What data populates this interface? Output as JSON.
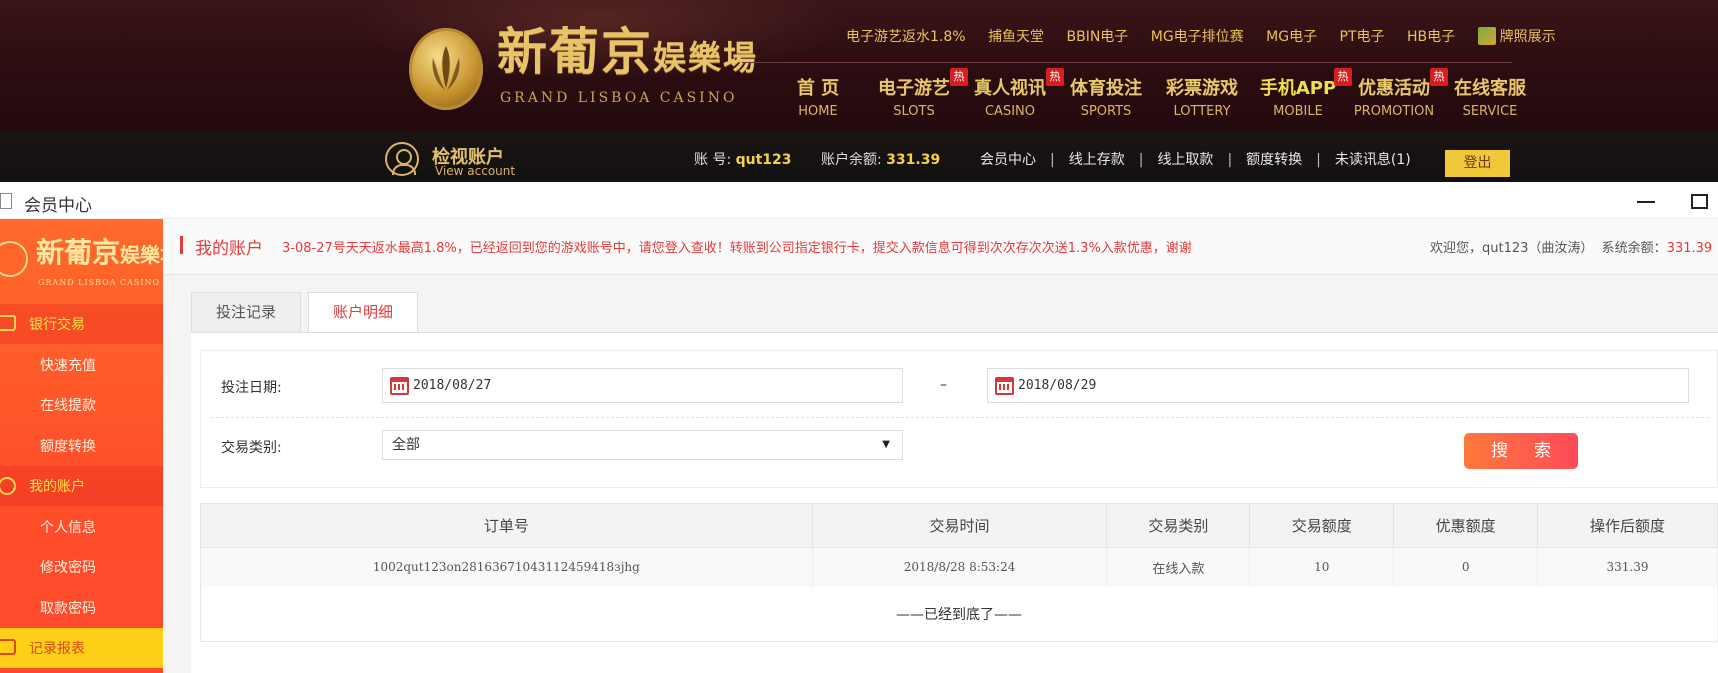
{
  "header": {
    "logo_cn_main": "新葡京",
    "logo_cn_small": "娱樂場",
    "logo_en": "GRAND LISBOA CASINO",
    "top_links": [
      "电子游艺返水1.8%",
      "捕鱼天堂",
      "BBIN电子",
      "MG电子排位赛",
      "MG电子",
      "PT电子",
      "HB电子"
    ],
    "license_link": "牌照展示",
    "nav": [
      {
        "cn": "首 页",
        "en": "HOME",
        "hot": ""
      },
      {
        "cn": "电子游艺",
        "en": "SLOTS",
        "hot": "热"
      },
      {
        "cn": "真人视讯",
        "en": "CASINO",
        "hot": "热"
      },
      {
        "cn": "体育投注",
        "en": "SPORTS",
        "hot": ""
      },
      {
        "cn": "彩票游戏",
        "en": "LOTTERY",
        "hot": ""
      },
      {
        "cn": "手机APP",
        "en": "MOBILE",
        "hot": "热"
      },
      {
        "cn": "优惠活动",
        "en": "PROMOTION",
        "hot": "热"
      },
      {
        "cn": "在线客服",
        "en": "SERVICE",
        "hot": ""
      }
    ]
  },
  "account_bar": {
    "view_cn": "检视账户",
    "view_en": "View account",
    "account_label": "账 号:",
    "account_value": "qut123",
    "balance_label": "账户余额:",
    "balance_value": "331.39",
    "links": [
      "会员中心",
      "线上存款",
      "线上取款",
      "额度转换",
      "未读讯息(1)"
    ],
    "logout": "登出"
  },
  "window": {
    "title": "会员中心"
  },
  "sidebar": {
    "logo_cn_main": "新葡京",
    "logo_cn_small": "娱樂場",
    "logo_en": "GRAND LISBOA CASINO",
    "groups": [
      {
        "label": "银行交易",
        "items": [
          "快速充值",
          "在线提款",
          "额度转换"
        ]
      },
      {
        "label": "我的账户",
        "items": [
          "个人信息",
          "修改密码",
          "取款密码"
        ]
      },
      {
        "label": "记录报表",
        "items": []
      }
    ]
  },
  "main": {
    "section_title": "我的账户",
    "marquee": "3-08-27号天天返水最高1.8%，已经返回到您的游戏账号中，请您登入查收！转账到公司指定银行卡，提交入款信息可得到次次存次次送1.3%入款优惠，谢谢",
    "welcome_prefix": "欢迎您，qut123（曲汝涛）  系统余额：",
    "welcome_balance": "331.39",
    "tabs": [
      "投注记录",
      "账户明细"
    ],
    "filters": {
      "date_label": "投注日期:",
      "date_from": "2018/08/27",
      "date_sep": "–",
      "date_to": "2018/08/29",
      "type_label": "交易类别:",
      "type_value": "全部",
      "search_label": "搜索"
    },
    "table": {
      "headers": [
        "订单号",
        "交易时间",
        "交易类别",
        "交易额度",
        "优惠额度",
        "操作后额度"
      ],
      "rows": [
        [
          "1002qut123on28163671043112459418зjhg",
          "2018/8/28 8:53:24",
          "在线入款",
          "10",
          "0",
          "331.39"
        ]
      ],
      "end_text": "——已经到底了——"
    }
  }
}
